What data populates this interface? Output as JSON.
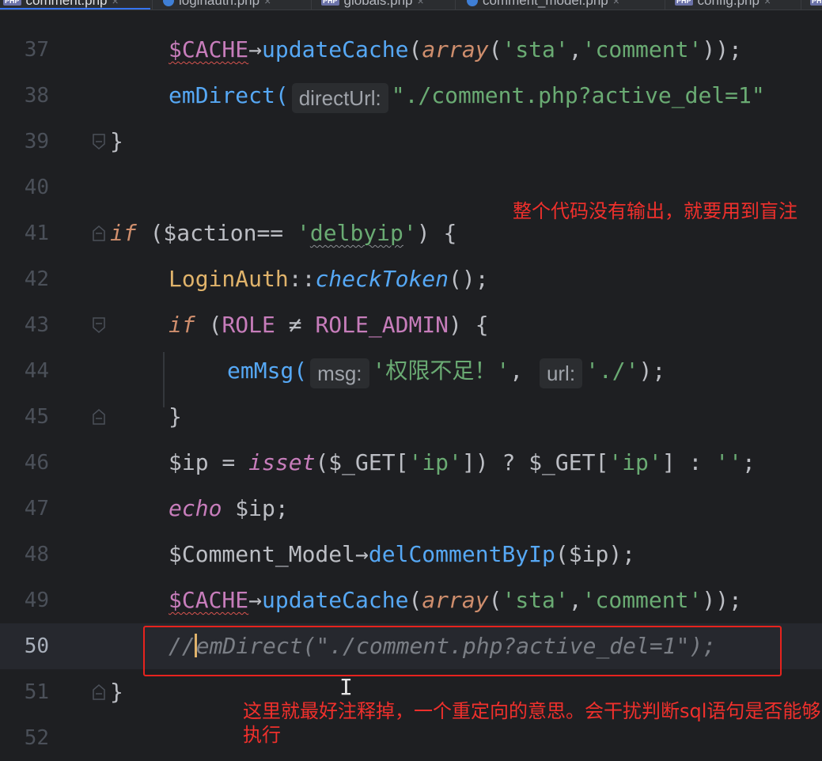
{
  "tabs": [
    {
      "label": "comment.php",
      "icon": "php-icon",
      "active": true
    },
    {
      "label": "loginauth.php",
      "icon": "class-icon",
      "active": false
    },
    {
      "label": "globals.php",
      "icon": "php-icon",
      "active": false
    },
    {
      "label": "comment_model.php",
      "icon": "class-icon",
      "active": false
    },
    {
      "label": "config.php",
      "icon": "php-icon",
      "active": false
    }
  ],
  "lines": {
    "l37": {
      "num": "37",
      "p1": "$CACHE",
      "p2": "→",
      "p3": "updateCache",
      "p4": "(",
      "p5": "array",
      "p6": "(",
      "p7": "'sta'",
      "p8": ",",
      "p9": "'comment'",
      "p10": "));"
    },
    "l38": {
      "num": "38",
      "p1": "emDirect(",
      "hint": "directUrl:",
      "p2": "\"./comment.php?active_del=1\""
    },
    "l39": {
      "num": "39",
      "p1": "}"
    },
    "l40": {
      "num": "40"
    },
    "l41": {
      "num": "41",
      "p1": "if",
      "p2": " ($action",
      "p3": "==",
      "p4": " '",
      "p5": "delbyip",
      "p6": "'",
      "p7": ") {"
    },
    "l42": {
      "num": "42",
      "p1": "LoginAuth",
      "p2": "::",
      "p3": "checkToken",
      "p4": "();"
    },
    "l43": {
      "num": "43",
      "p1": "if",
      "p2": " (",
      "p3": "ROLE",
      "p4": " ≠ ",
      "p5": "ROLE_ADMIN",
      "p6": ") {"
    },
    "l44": {
      "num": "44",
      "p1": "emMsg(",
      "hint1": "msg:",
      "p2": "'权限不足！'",
      "p3": ",",
      "hint2": "url:",
      "p4": "'./'",
      "p5": ");"
    },
    "l45": {
      "num": "45",
      "p1": "}"
    },
    "l46": {
      "num": "46",
      "p1": "$ip",
      "p2": " = ",
      "p3": "isset",
      "p4": "($_GET[",
      "p5": "'ip'",
      "p6": "]) ? $_GET[",
      "p7": "'ip'",
      "p8": "] : ",
      "p9": "''",
      "p10": ";"
    },
    "l47": {
      "num": "47",
      "p1": "echo",
      "p2": " $ip;"
    },
    "l48": {
      "num": "48",
      "p1": "$Comment_Model",
      "p2": "→",
      "p3": "delCommentByIp",
      "p4": "($ip);"
    },
    "l49": {
      "num": "49",
      "p1": "$CACHE",
      "p2": "→",
      "p3": "updateCache",
      "p4": "(",
      "p5": "array",
      "p6": "(",
      "p7": "'sta'",
      "p8": ",",
      "p9": "'comment'",
      "p10": "));"
    },
    "l50": {
      "num": "50",
      "p1": "//",
      "p2": "emDirect(\"./comment.php?active_del=1\");"
    },
    "l51": {
      "num": "51",
      "p1": "}"
    },
    "l52": {
      "num": "52"
    }
  },
  "annotations": {
    "top": "整个代码没有输出，就要用到盲注",
    "bottom": "这里就最好注释掉，一个重定向的意思。会干扰判断sql语句是否能够执行"
  },
  "colors": {
    "background": "#1e1f22",
    "annotation": "#f0302c",
    "highlight_box": "#e6231e",
    "keyword": "#cf8e6d",
    "string": "#6aab73",
    "function": "#56a8f5",
    "constant": "#c77dbb"
  }
}
